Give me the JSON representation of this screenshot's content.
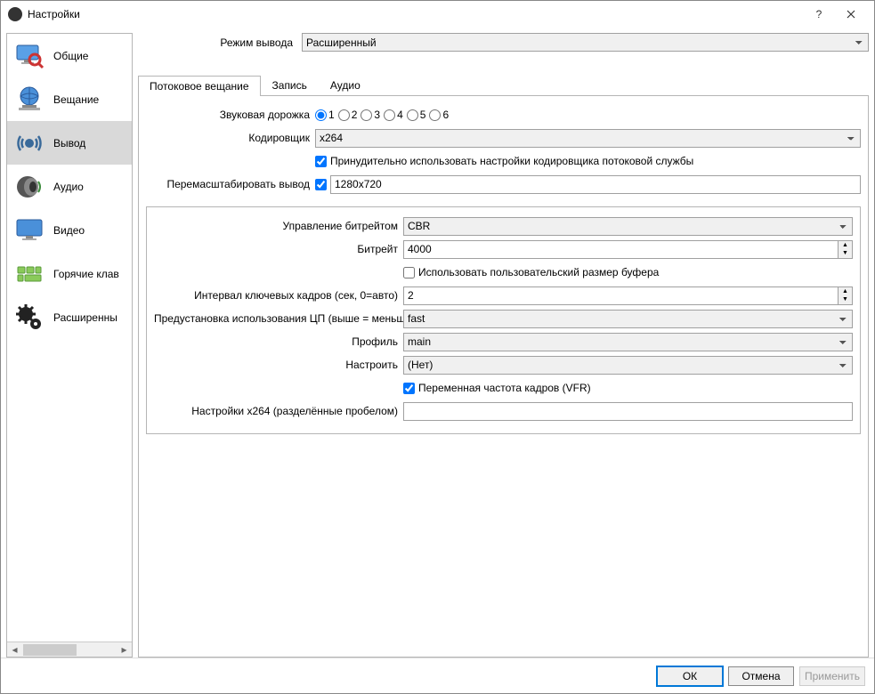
{
  "window": {
    "title": "Настройки"
  },
  "sidebar": {
    "items": [
      {
        "label": "Общие"
      },
      {
        "label": "Вещание"
      },
      {
        "label": "Вывод"
      },
      {
        "label": "Аудио"
      },
      {
        "label": "Видео"
      },
      {
        "label": "Горячие клав"
      },
      {
        "label": "Расширенны"
      }
    ]
  },
  "top": {
    "mode_label": "Режим вывода",
    "mode_value": "Расширенный"
  },
  "tabs": {
    "streaming": "Потоковое вещание",
    "recording": "Запись",
    "audio": "Аудио"
  },
  "form": {
    "audio_track_label": "Звуковая дорожка",
    "tracks": [
      "1",
      "2",
      "3",
      "4",
      "5",
      "6"
    ],
    "encoder_label": "Кодировщик",
    "encoder_value": "x264",
    "enforce_label": "Принудительно использовать настройки кодировщика потоковой службы",
    "rescale_label": "Перемасштабировать вывод",
    "rescale_value": "1280x720"
  },
  "enc": {
    "rate_control_label": "Управление битрейтом",
    "rate_control_value": "CBR",
    "bitrate_label": "Битрейт",
    "bitrate_value": "4000",
    "custom_buf_label": "Использовать пользовательский размер буфера",
    "keyint_label": "Интервал ключевых кадров (сек, 0=авто)",
    "keyint_value": "2",
    "preset_label": "Предустановка использования ЦП (выше = меньше)",
    "preset_value": "fast",
    "profile_label": "Профиль",
    "profile_value": "main",
    "tune_label": "Настроить",
    "tune_value": "(Нет)",
    "vfr_label": "Переменная частота кадров (VFR)",
    "x264opts_label": "Настройки x264 (разделённые пробелом)",
    "x264opts_value": ""
  },
  "footer": {
    "ok": "ОК",
    "cancel": "Отмена",
    "apply": "Применить"
  }
}
